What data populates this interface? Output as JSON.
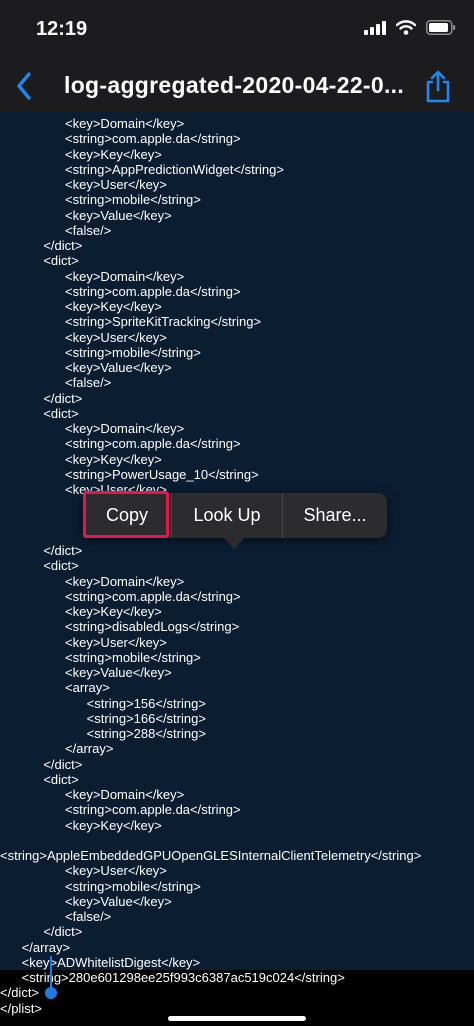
{
  "status_bar": {
    "time": "12:19"
  },
  "nav": {
    "title": "log-aggregated-2020-04-22-0..."
  },
  "code_lines": [
    "                  <key>Domain</key>",
    "                  <string>com.apple.da</string>",
    "                  <key>Key</key>",
    "                  <string>AppPredictionWidget</string>",
    "                  <key>User</key>",
    "                  <string>mobile</string>",
    "                  <key>Value</key>",
    "                  <false/>",
    "            </dict>",
    "            <dict>",
    "                  <key>Domain</key>",
    "                  <string>com.apple.da</string>",
    "                  <key>Key</key>",
    "                  <string>SpriteKitTracking</string>",
    "                  <key>User</key>",
    "                  <string>mobile</string>",
    "                  <key>Value</key>",
    "                  <false/>",
    "            </dict>",
    "            <dict>",
    "                  <key>Domain</key>",
    "                  <string>com.apple.da</string>",
    "                  <key>Key</key>",
    "                  <string>PowerUsage_10</string>",
    "                  <key>User</key>",
    "",
    "",
    "",
    "            </dict>",
    "            <dict>",
    "                  <key>Domain</key>",
    "                  <string>com.apple.da</string>",
    "                  <key>Key</key>",
    "                  <string>disabledLogs</string>",
    "                  <key>User</key>",
    "                  <string>mobile</string>",
    "                  <key>Value</key>",
    "                  <array>",
    "                        <string>156</string>",
    "                        <string>166</string>",
    "                        <string>288</string>",
    "                  </array>",
    "            </dict>",
    "            <dict>",
    "                  <key>Domain</key>",
    "                  <string>com.apple.da</string>",
    "                  <key>Key</key>",
    "",
    "<string>AppleEmbeddedGPUOpenGLESInternalClientTelemetry</string>",
    "                  <key>User</key>",
    "                  <string>mobile</string>",
    "                  <key>Value</key>",
    "                  <false/>",
    "            </dict>",
    "      </array>",
    "      <key>ADWhitelistDigest</key>",
    "      <string>280e601298ee25f993c6387ac519c024</string>",
    "</dict>",
    "</plist>"
  ],
  "menu": {
    "copy": "Copy",
    "look_up": "Look Up",
    "share": "Share..."
  }
}
